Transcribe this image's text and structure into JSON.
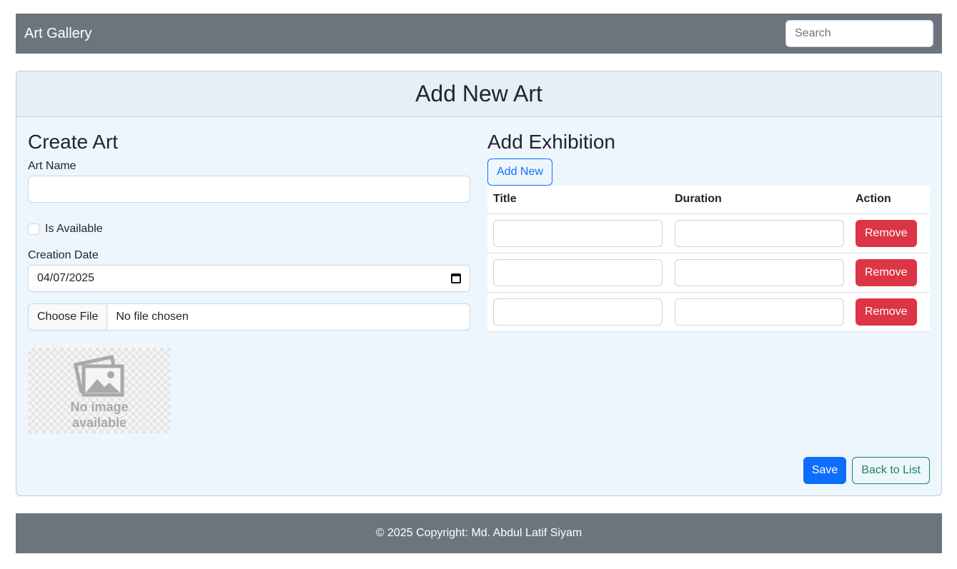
{
  "navbar": {
    "brand": "Art Gallery",
    "search_placeholder": "Search"
  },
  "card": {
    "title": "Add New Art"
  },
  "create_art": {
    "heading": "Create Art",
    "art_name_label": "Art Name",
    "art_name_value": "",
    "is_available_label": "Is Available",
    "is_available_checked": false,
    "creation_date_label": "Creation Date",
    "creation_date_value": "04/07/2025",
    "file_button_label": "Choose File",
    "file_status": "No file chosen",
    "image_placeholder_line1": "No image",
    "image_placeholder_line2": "available"
  },
  "exhibition": {
    "heading": "Add Exhibition",
    "add_new_label": "Add New",
    "columns": [
      "Title",
      "Duration",
      "Action"
    ],
    "rows": [
      {
        "title": "",
        "duration": "",
        "action_label": "Remove"
      },
      {
        "title": "",
        "duration": "",
        "action_label": "Remove"
      },
      {
        "title": "",
        "duration": "",
        "action_label": "Remove"
      }
    ]
  },
  "actions": {
    "save_label": "Save",
    "back_label": "Back to List"
  },
  "footer": {
    "copyright": "© 2025 Copyright: Md. Abdul Latif Siyam"
  },
  "colors": {
    "navbar_bg": "#6c757d",
    "card_bg": "#eef6fd",
    "primary": "#0d6efd",
    "danger": "#dc3545",
    "success": "#198754"
  }
}
